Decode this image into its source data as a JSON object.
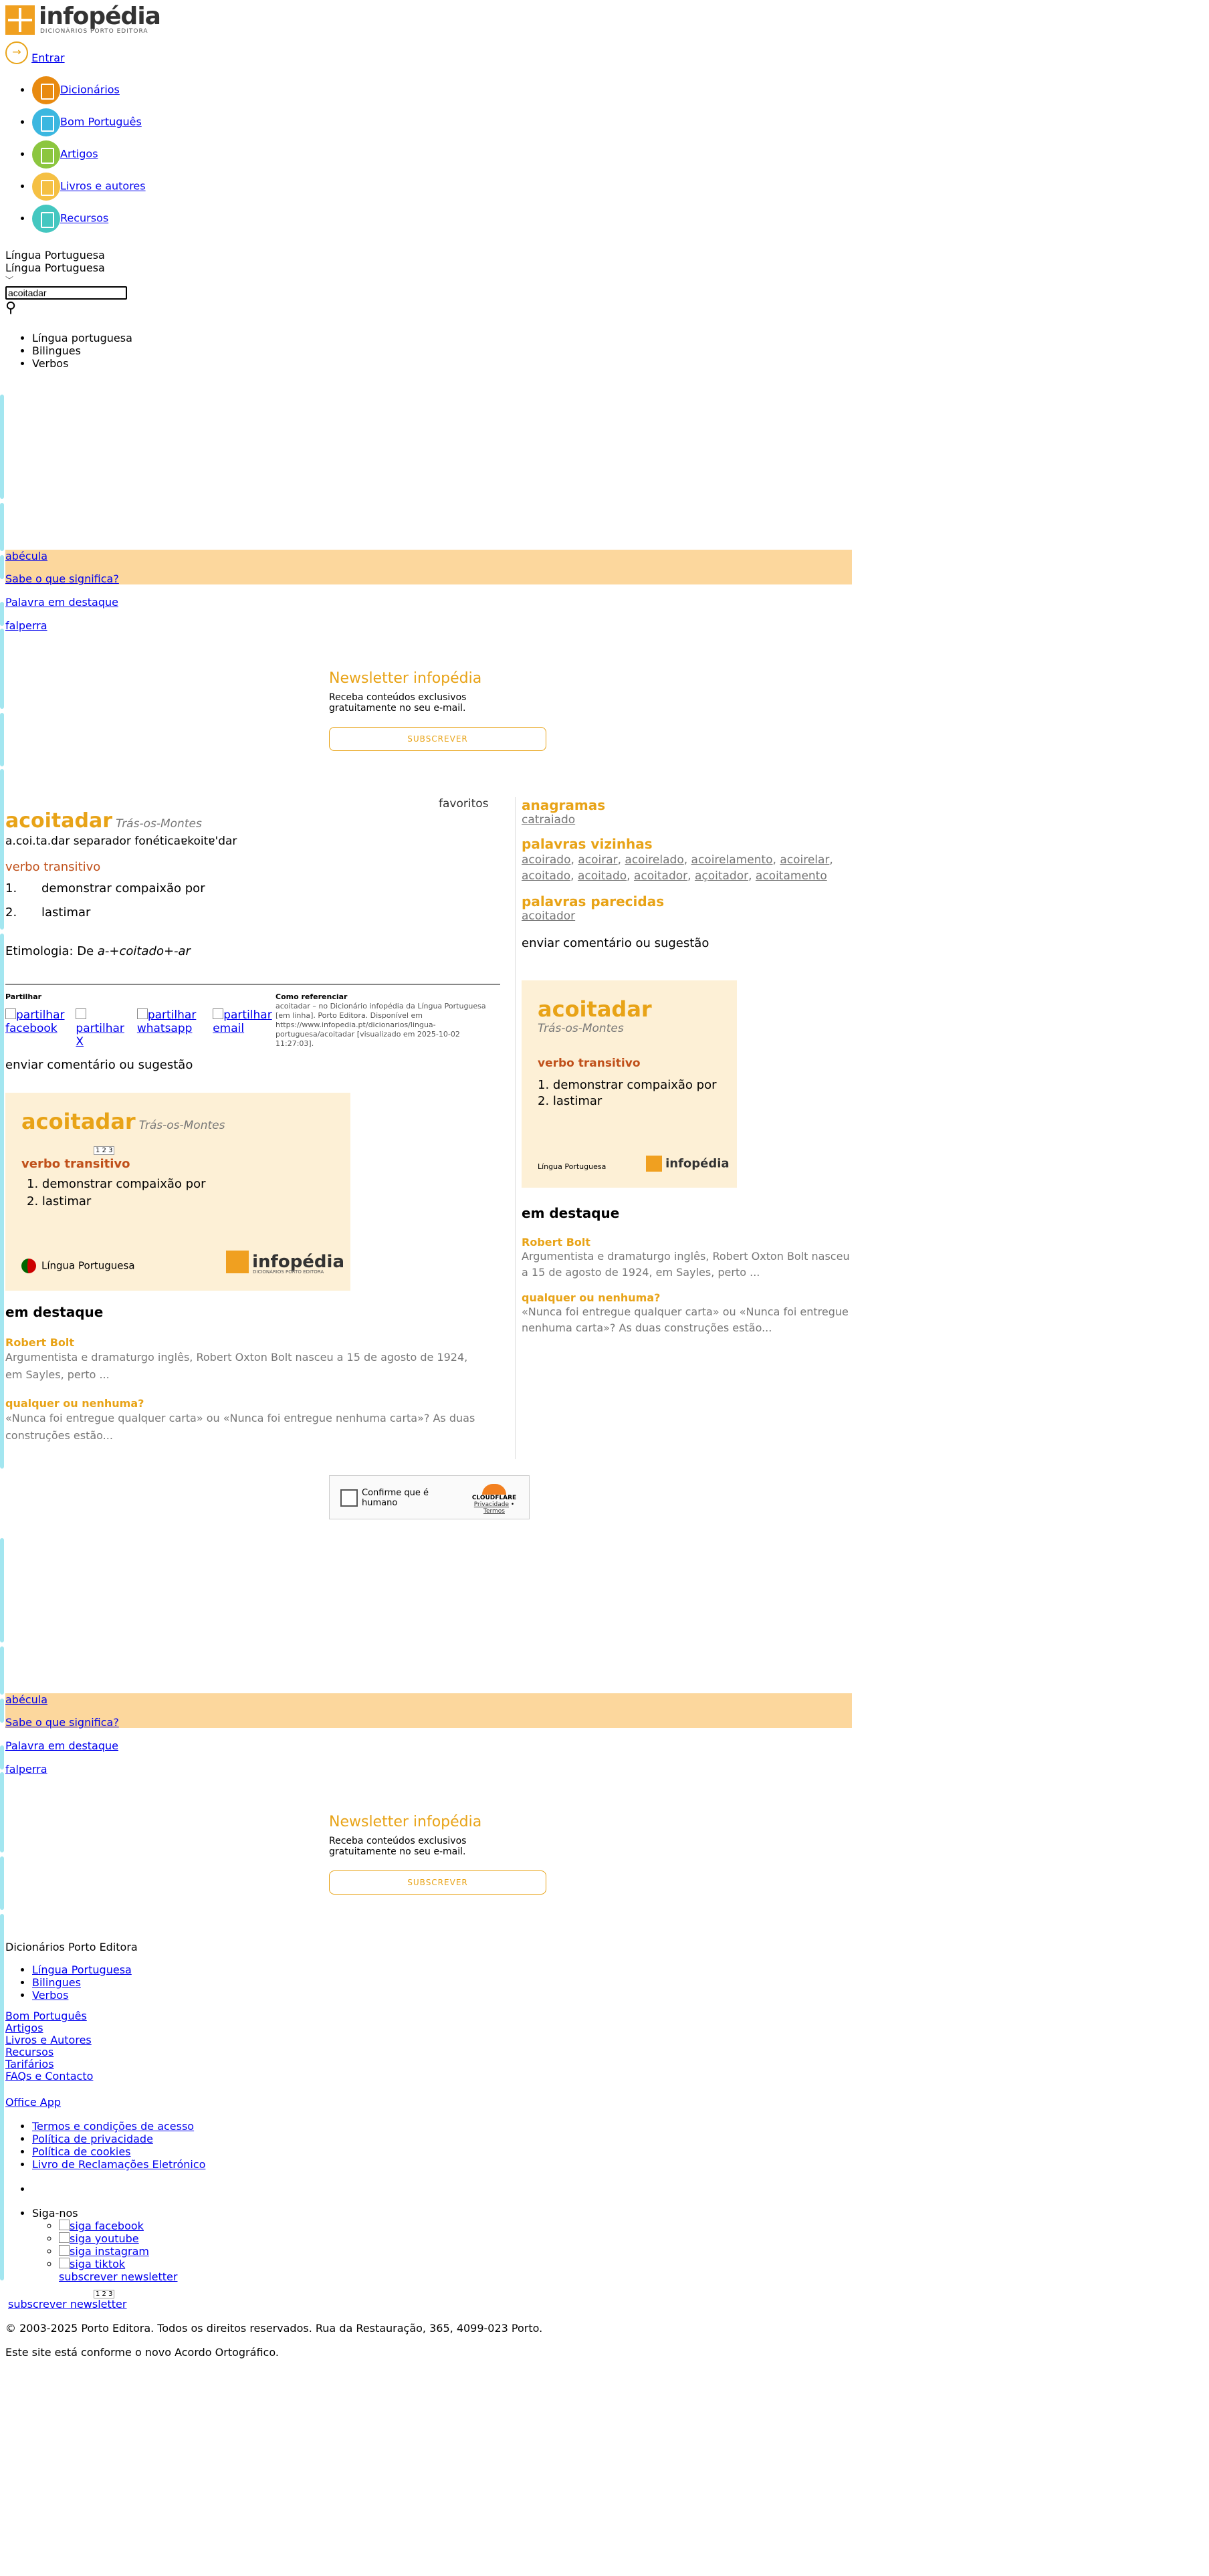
{
  "header": {
    "logo_text": "infopédia",
    "logo_sub": "DICIONÁRIOS PORTO EDITORA",
    "login": "Entrar"
  },
  "nav": [
    {
      "label": "Dicionários",
      "color": "#e88a10"
    },
    {
      "label": "Bom Português",
      "color": "#3bb7e0"
    },
    {
      "label": "Artigos",
      "color": "#8cc63f"
    },
    {
      "label": "Livros e autores",
      "color": "#f5c043"
    },
    {
      "label": "Recursos",
      "color": "#44c7c0"
    }
  ],
  "search": {
    "lang_label1": "Língua Portuguesa",
    "lang_label2": "Língua Portuguesa",
    "value": "acoitadar",
    "tabs": [
      "Língua portuguesa",
      "Bilingues",
      "Verbos"
    ]
  },
  "promo": {
    "word": "abécula",
    "know": "Sabe o que significa?",
    "featured": "Palavra em destaque",
    "featured_word": "falperra"
  },
  "newsletter": {
    "title": "Newsletter infopédia",
    "text": "Receba conteúdos exclusivos gratuitamente no seu e-mail.",
    "button": "SUBSCREVER"
  },
  "entry": {
    "favorites_alt": "favoritos",
    "word": "acoitadar",
    "region": "Trás-os-Montes",
    "syllables": "a.coi.ta.dar",
    "sep_alt": "separador fonética",
    "phonetic": "ɐkoitɐ'dar",
    "pos": "verbo transitivo",
    "senses": [
      "demonstrar compaixão por",
      "lastimar"
    ],
    "etym_label": "Etimologia: De",
    "etym_value": "a-+coitado+-ar"
  },
  "share": {
    "title": "Partilhar",
    "items": [
      "partilhar facebook",
      "partilhar X",
      "partilhar whatsapp",
      "partilhar email"
    ]
  },
  "cite": {
    "title": "Como referenciar",
    "text": "acoitadar – no Dicionário infopédia da Língua Portuguesa [em linha]. Porto Editora. Disponível em https://www.infopedia.pt/dicionarios/lingua-portuguesa/acoitadar [visualizado em 2025-10-02 11:27:03]."
  },
  "comment": "enviar comentário ou sugestão",
  "card": {
    "word": "acoitadar",
    "region": "Trás-os-Montes",
    "pos": "verbo transitivo",
    "senses": [
      "1. demonstrar compaixão por",
      "2. lastimar"
    ],
    "lang": "Língua Portuguesa",
    "logo": "infopédia",
    "logo_sub": "DICIONÁRIOS PORTO EDITORA",
    "pager": "1 2 3"
  },
  "highlights": {
    "title": "em destaque",
    "items": [
      {
        "title": "Robert Bolt",
        "text": "Argumentista e dramaturgo inglês, Robert Oxton Bolt nasceu a 15 de agosto de 1924, em Sayles, perto ..."
      },
      {
        "title": "qualquer ou nenhuma?",
        "text": "«Nunca foi entregue qualquer carta» ou «Nunca foi entregue nenhuma carta»? As duas construções estão..."
      }
    ]
  },
  "sidebar": {
    "anagrams_title": "anagramas",
    "anagrams": [
      "catraiado"
    ],
    "neighbors_title": "palavras vizinhas",
    "neighbors": [
      "acoirado",
      "acoirar",
      "acoirelado",
      "acoirelamento",
      "acoirelar",
      "acoitado",
      "acoitado",
      "acoitador",
      "açoitador",
      "acoitamento"
    ],
    "similar_title": "palavras parecidas",
    "similar": [
      "acoitador"
    ]
  },
  "captcha": {
    "label": "Confirme que é humano",
    "brand": "CLOUDFLARE",
    "privacy": "Privacidade",
    "terms": "Termos"
  },
  "footer": {
    "dict_title": "Dicionários Porto Editora",
    "dict_links": [
      "Língua Portuguesa",
      "Bilingues",
      "Verbos"
    ],
    "links": [
      "Bom Português",
      "Artigos",
      "Livros e Autores",
      "Recursos",
      "Tarifários",
      "FAQs e Contacto"
    ],
    "office": "Office App",
    "legal": [
      "Termos e condições de acesso",
      "Política de privacidade",
      "Política de cookies",
      "Livro de Reclamações Eletrónico"
    ],
    "follow": "Siga-nos",
    "social": [
      "siga facebook",
      "siga youtube",
      "siga instagram",
      "siga tiktok"
    ],
    "subscribe": "subscrever newsletter",
    "subscribe2": "subscrever newsletter",
    "pager": "1 2 3",
    "copyright": "© 2003-2025 Porto Editora. Todos os direitos reservados. Rua da Restauração, 365, 4099-023 Porto.",
    "ao": "Este site está conforme o novo Acordo Ortográfico."
  }
}
